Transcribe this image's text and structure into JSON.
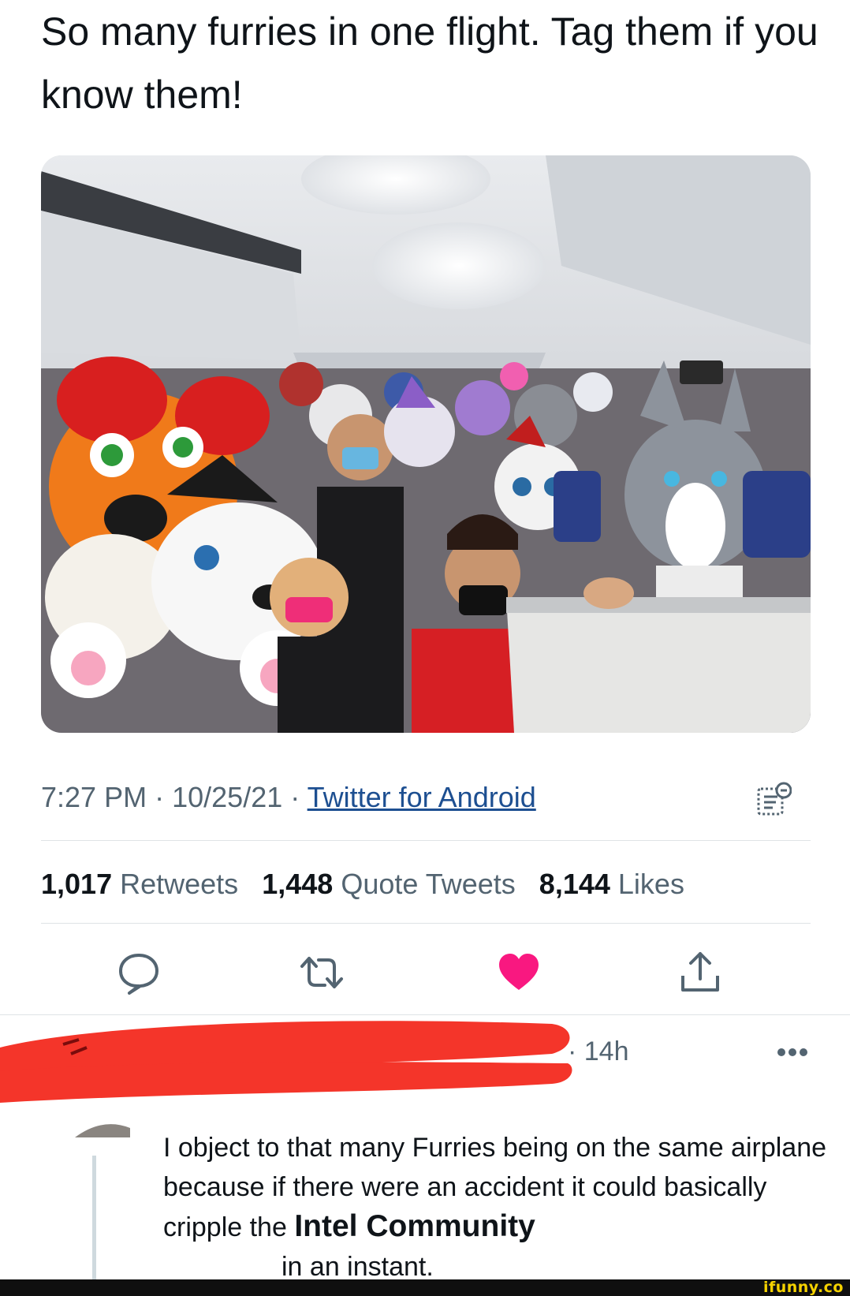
{
  "tweet": {
    "text": "So many furries in one flight. Tag them if you know them!",
    "time": "7:27 PM",
    "date": "10/25/21",
    "separator": "·",
    "source": "Twitter for Android",
    "analytics_icon": "analytics-icon"
  },
  "stats": {
    "retweets_count": "1,017",
    "retweets_label": "Retweets",
    "quotes_count": "1,448",
    "quotes_label": "Quote Tweets",
    "likes_count": "8,144",
    "likes_label": "Likes"
  },
  "actions": {
    "icons": [
      "reply-icon",
      "retweet-icon",
      "like-icon",
      "share-icon"
    ],
    "like_color": "#f91880"
  },
  "reply": {
    "time": "· 14h",
    "more_icon": "more-icon",
    "text_before": "I object to that many Furries being on the same airplane because if there were an accident it could basically cripple the ",
    "text_emphasis": "Intel Community",
    "text_after": "in an instant.",
    "redaction_color": "#f4352a"
  },
  "watermark": "ifunny.co"
}
